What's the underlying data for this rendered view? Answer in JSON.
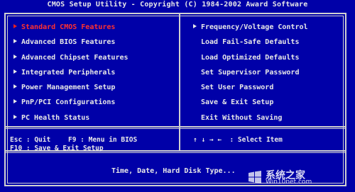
{
  "title": "CMOS Setup Utility - Copyright (C) 1984-2002 Award Software",
  "left_menu": [
    {
      "label": "Standard CMOS Features",
      "selected": true
    },
    {
      "label": "Advanced BIOS Features",
      "selected": false
    },
    {
      "label": "Advanced Chipset Features",
      "selected": false
    },
    {
      "label": "Integrated Peripherals",
      "selected": false
    },
    {
      "label": "Power Management Setup",
      "selected": false
    },
    {
      "label": "PnP/PCI Configurations",
      "selected": false
    },
    {
      "label": "PC Health Status",
      "selected": false
    }
  ],
  "right_menu": [
    {
      "label": "Frequency/Voltage Control",
      "arrow": true
    },
    {
      "label": "Load Fail-Safe Defaults",
      "arrow": false
    },
    {
      "label": "Load Optimized Defaults",
      "arrow": false
    },
    {
      "label": "Set Supervisor Password",
      "arrow": false
    },
    {
      "label": "Set User Password",
      "arrow": false
    },
    {
      "label": "Save & Exit Setup",
      "arrow": false
    },
    {
      "label": "Exit Without Saving",
      "arrow": false
    }
  ],
  "help": {
    "esc": "Esc : Quit",
    "f9": "F9 : Menu in BIOS",
    "arrows": "↑ ↓ → ←  : Select Item",
    "f10": "F10 : Save & Exit Setup"
  },
  "description": "Time, Date, Hard Disk Type...",
  "watermark": {
    "main": "系统之家",
    "sub": "Win10net.com"
  },
  "colors": {
    "background": "#0000a8",
    "text": "#e8e8e8",
    "selected": "#ff3030"
  }
}
